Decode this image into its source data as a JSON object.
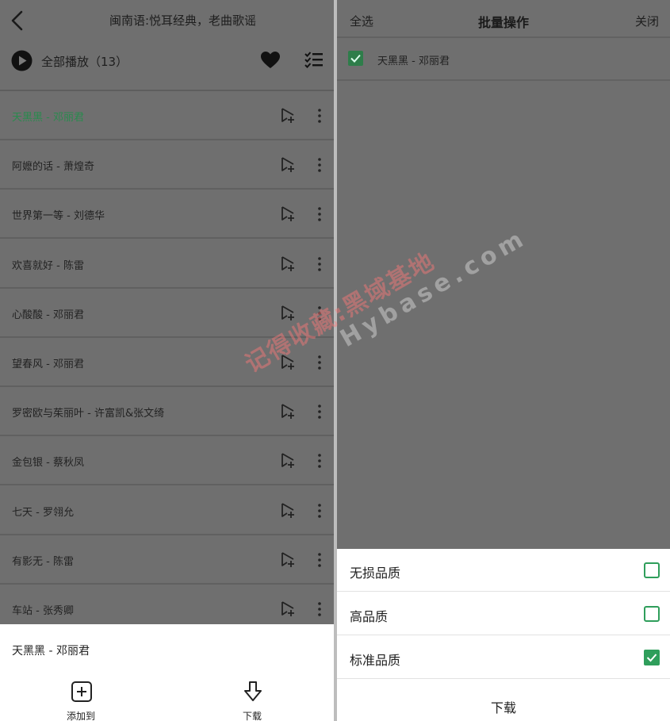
{
  "left": {
    "header": {
      "title": "闽南语:悦耳经典，老曲歌谣"
    },
    "playall": {
      "label": "全部播放（13）"
    },
    "songs": [
      {
        "title": "天黑黑 - 邓丽君",
        "active": true
      },
      {
        "title": "阿嬷的话 - 萧煌奇"
      },
      {
        "title": "世界第一等 - 刘德华"
      },
      {
        "title": "欢喜就好 - 陈雷"
      },
      {
        "title": "心酸酸 - 邓丽君"
      },
      {
        "title": "望春风 - 邓丽君"
      },
      {
        "title": "罗密欧与茱丽叶 - 许富凯&张文绮"
      },
      {
        "title": "金包银 - 蔡秋凤"
      },
      {
        "title": "七天 - 罗翎允"
      },
      {
        "title": "有影无 - 陈雷"
      },
      {
        "title": "车站 - 张秀卿"
      }
    ],
    "sheet": {
      "song": "天黑黑 - 邓丽君",
      "add_label": "添加到",
      "download_label": "下载"
    }
  },
  "right": {
    "header": {
      "select_all": "全选",
      "title": "批量操作",
      "close": "关闭"
    },
    "selected_song": "天黑黑 - 邓丽君",
    "quality_options": [
      {
        "label": "无损品质",
        "checked": false
      },
      {
        "label": "高品质",
        "checked": false
      },
      {
        "label": "标准品质",
        "checked": true
      }
    ],
    "download_label": "下载"
  },
  "watermark": {
    "line1": "记得收藏:黑域基地",
    "line2": "Hybase.com"
  },
  "colors": {
    "accent": "#2a8a4e",
    "check_green": "#2f9e5b"
  },
  "icons": [
    "back-icon",
    "play-icon",
    "heart-icon",
    "list-check-icon",
    "add-to-playlist-icon",
    "more-vertical-icon",
    "add-square-icon",
    "download-arrow-icon",
    "checkbox-icon"
  ]
}
